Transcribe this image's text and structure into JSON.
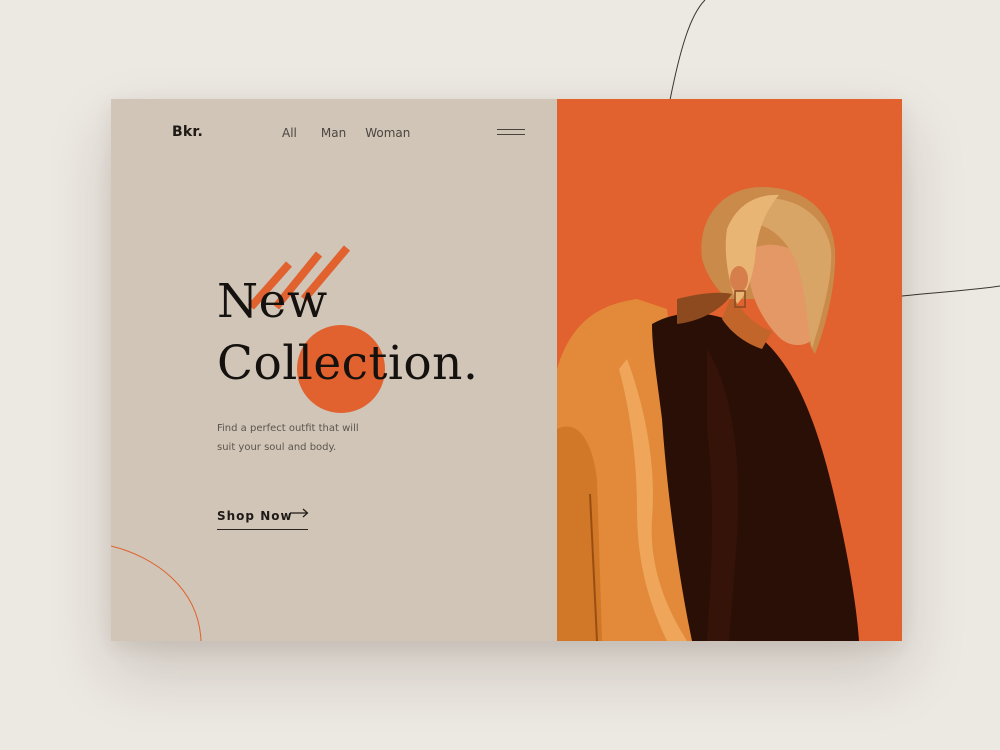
{
  "brand": {
    "logo": "Bkr."
  },
  "nav": {
    "items": [
      "All",
      "Man",
      "Woman"
    ]
  },
  "menu": {
    "icon": "hamburger-menu-icon"
  },
  "hero": {
    "headline_line1": "New",
    "headline_line2": "Collection.",
    "description_line1": "Find a perfect outfit  that will",
    "description_line2": "suit your soul and body.",
    "cta_label": "Shop Now",
    "cta_icon": "arrow-right-icon"
  },
  "colors": {
    "background": "#ece8e2",
    "panel_left": "#d0c5b6",
    "accent": "#e1612f",
    "text_dark": "#15110e",
    "jacket": "#e28a3a",
    "hoodie": "#2a0f06"
  },
  "image": {
    "subject": "model-photo",
    "icon": "person-photo-icon"
  }
}
